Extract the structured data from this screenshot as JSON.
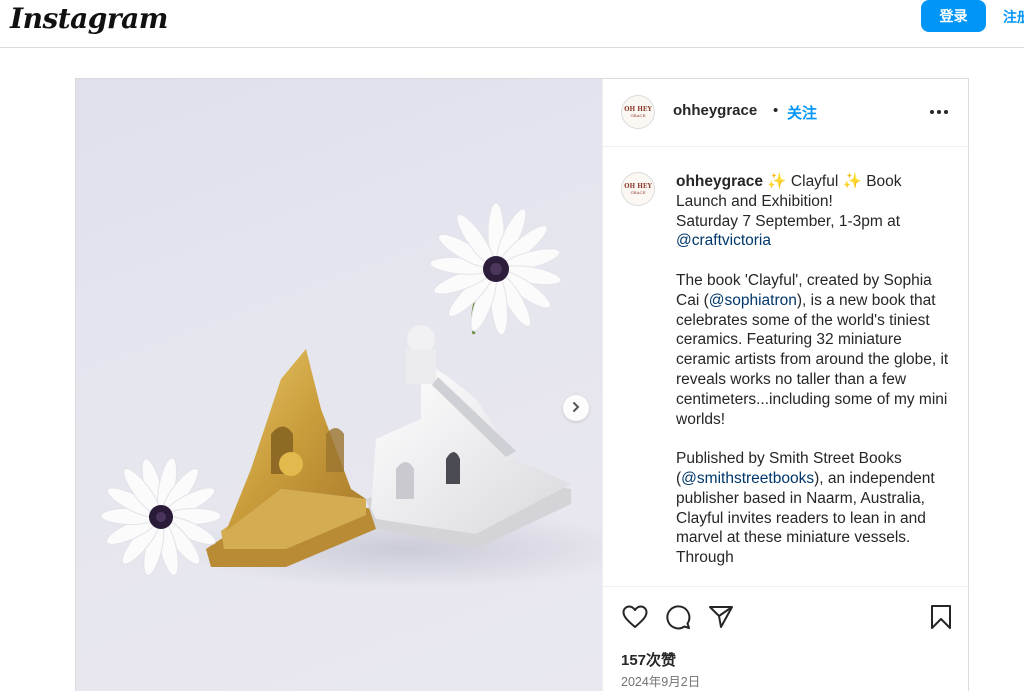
{
  "app": {
    "logo_text": "Instagram"
  },
  "header": {
    "login_label": "登录",
    "signup_label": "注册"
  },
  "post": {
    "username": "ohheygrace",
    "separator": "•",
    "follow_label": "关注",
    "avatar_text_line1": "OH HEY",
    "avatar_text_line2": "GRACE",
    "caption": {
      "username": "ohheygrace",
      "p1_a": " ✨ Clayful ✨ Book Launch and Exhibition!\nSaturday 7 September, 1-3pm at ",
      "mention1": "@craftvictoria",
      "p2_a": "\n\nThe book 'Clayful', created by Sophia Cai (",
      "mention2": "@sophiatron",
      "p2_b": "), is a new book that celebrates some of the world's tiniest ceramics. Featuring 32 miniature ceramic artists from around the globe, it reveals works no taller than a few centimeters...including some of my mini worlds!\n\nPublished by Smith Street Books (",
      "mention3": "@smithstreetbooks",
      "p3_b": "), an independent publisher based in Naarm, Australia, Clayful invites readers to lean in and marvel at these miniature vessels. Through"
    },
    "likes_text": "157次赞",
    "date_text": "2024年9月2日"
  },
  "icons": {
    "more": "more-icon",
    "next": "chevron-right-icon",
    "like": "heart-icon",
    "comment": "comment-icon",
    "share": "share-icon",
    "save": "bookmark-icon"
  },
  "colors": {
    "accent": "#0095f6",
    "mention": "#00376b",
    "text": "#262626",
    "muted": "#737373",
    "border": "#dbdbdb"
  }
}
